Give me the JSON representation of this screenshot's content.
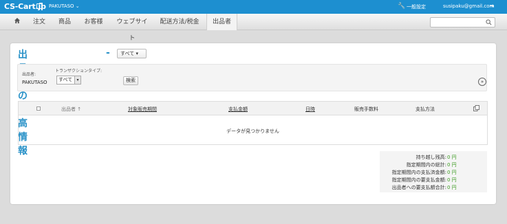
{
  "topbar": {
    "logo": "CS-Cart.jp",
    "vendor": "PAKUTASO ⌄",
    "settings": "一般設定",
    "email": "susipaku@gmail.com"
  },
  "nav": {
    "items": [
      "注文",
      "商品",
      "お客様",
      "ウェブサイト",
      "配送方法/税金",
      "出品者"
    ],
    "active": "出品者"
  },
  "page": {
    "title": "出品者の残高情報",
    "title_dash": "-",
    "title_select": "すべて ▾"
  },
  "filter": {
    "vendor_label": "出品者:",
    "vendor_value": "PAKUTASO",
    "transaction_label": "トランザクションタイプ:",
    "transaction_value": "すべて",
    "search_button": "検索"
  },
  "table": {
    "headers": [
      "出品者 ↑",
      "対象販売期間",
      "支払金額",
      "日時",
      "販売手数料",
      "支払方法"
    ],
    "empty_text": "データが見つかりません"
  },
  "summary": {
    "rows": [
      {
        "label": "持ち越し残高:",
        "value": "0 円"
      },
      {
        "label": "指定期間内の総計:",
        "value": "0 円"
      },
      {
        "label": "指定期間内の支払済金額:",
        "value": "0 円"
      },
      {
        "label": "指定期間内の要支払金額:",
        "value": "0 円"
      },
      {
        "label": "出品者への要支払額合計:",
        "value": "0 円"
      }
    ]
  },
  "colors": {
    "topbar": "#1d8fd0",
    "title": "#2a92c8",
    "summary_value": "#3a9a1f"
  }
}
